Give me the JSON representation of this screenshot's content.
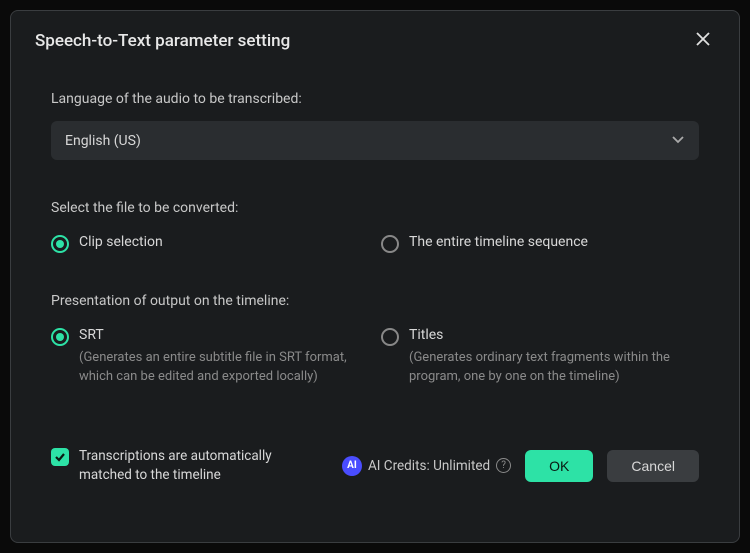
{
  "dialog": {
    "title": "Speech-to-Text parameter setting"
  },
  "language": {
    "label": "Language of the audio to be transcribed:",
    "value": "English (US)"
  },
  "fileSelect": {
    "label": "Select the file to be converted:",
    "options": {
      "clip": "Clip selection",
      "entire": "The entire timeline sequence"
    }
  },
  "output": {
    "label": "Presentation of output on the timeline:",
    "srt": {
      "title": "SRT",
      "desc": "(Generates an entire subtitle file in SRT format, which can be edited and exported locally)"
    },
    "titles": {
      "title": "Titles",
      "desc": "(Generates ordinary text fragments within the program, one by one on the timeline)"
    }
  },
  "checkbox": {
    "label": "Transcriptions are automatically matched to the timeline"
  },
  "credits": {
    "badge": "AI",
    "text": "AI Credits: Unlimited"
  },
  "buttons": {
    "ok": "OK",
    "cancel": "Cancel"
  }
}
